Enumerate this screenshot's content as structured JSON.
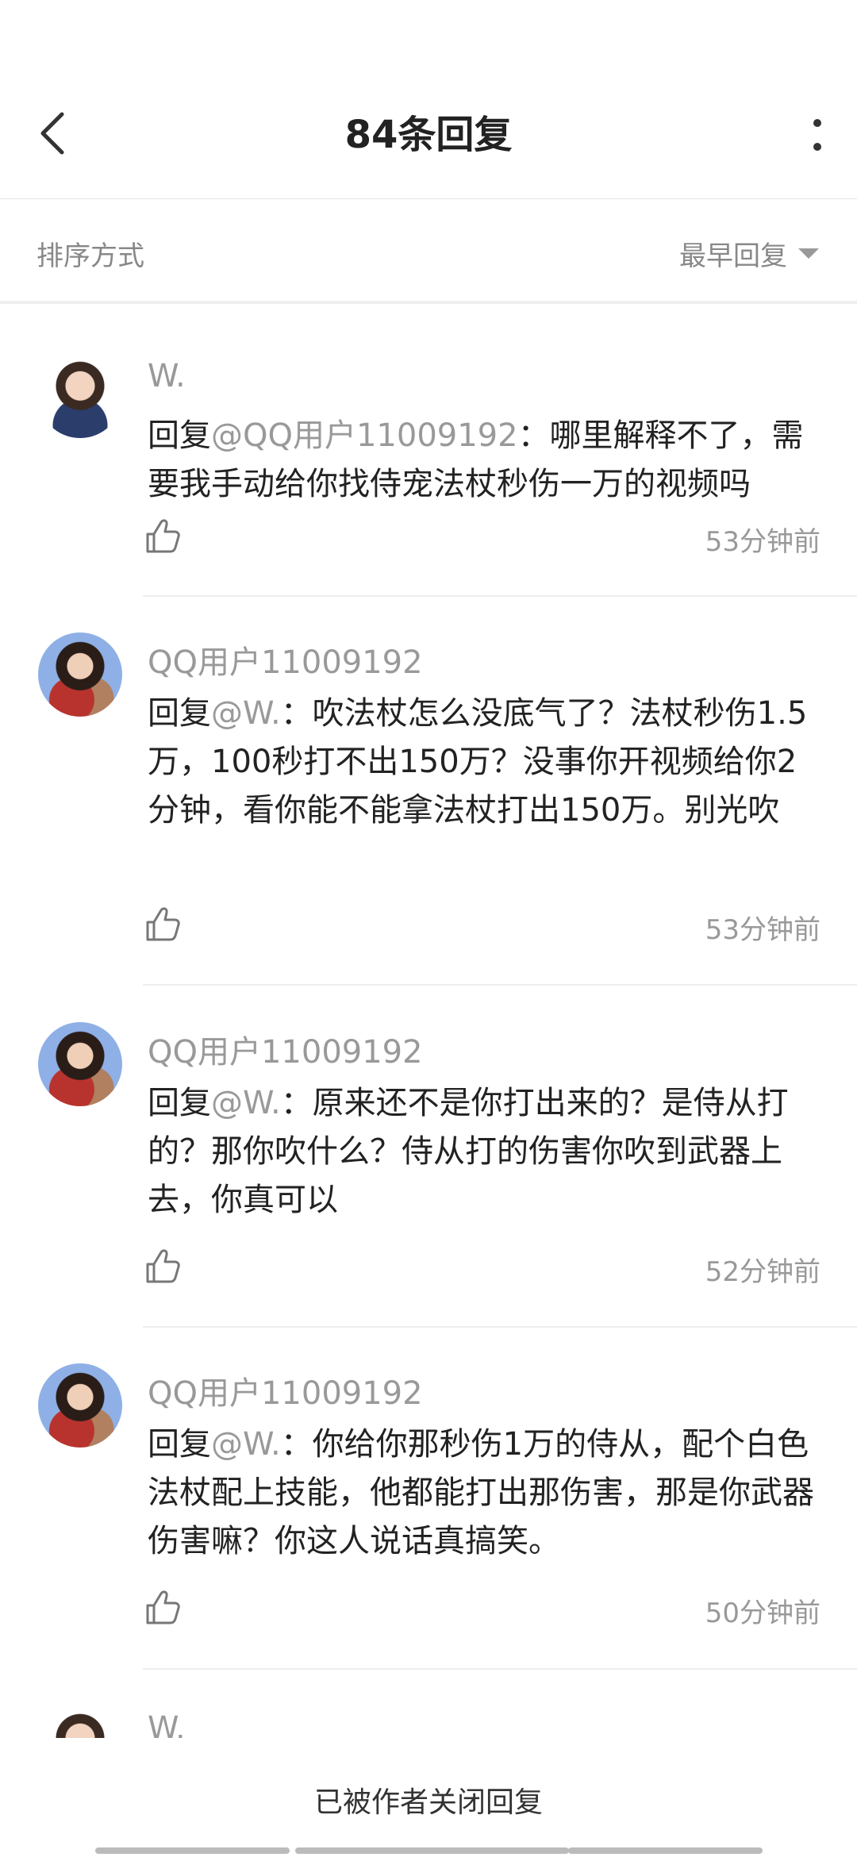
{
  "header": {
    "title": "84条回复",
    "back_icon": "chevron-left-icon",
    "more_icon": "vertical-dots-icon"
  },
  "sort": {
    "label": "排序方式",
    "value": "最早回复"
  },
  "comments": [
    {
      "author": "W.",
      "reply_prefix": "回复",
      "mention": "@QQ用户11009192",
      "text": "：哪里解释不了，需要我手动给你找侍宠法杖秒伤一万的视频吗",
      "time": "53分钟前"
    },
    {
      "author": "QQ用户11009192",
      "reply_prefix": "回复",
      "mention": "@W.",
      "text": "：吹法杖怎么没底气了？法杖秒伤1.5万，100秒打不出150万？没事你开视频给你2分钟，看你能不能拿法杖打出150万。别光吹",
      "time": "53分钟前"
    },
    {
      "author": "QQ用户11009192",
      "reply_prefix": "回复",
      "mention": "@W.",
      "text": "：原来还不是你打出来的？是侍从打的？那你吹什么？侍从打的伤害你吹到武器上去，你真可以",
      "time": "52分钟前"
    },
    {
      "author": "QQ用户11009192",
      "reply_prefix": "回复",
      "mention": "@W.",
      "text": "：你给你那秒伤1万的侍从，配个白色法杖配上技能，他都能打出那伤害，那是你武器伤害嘛？你这人说话真搞笑。",
      "time": "50分钟前"
    },
    {
      "author": "W.",
      "reply_prefix": "",
      "mention": "",
      "text": "",
      "time": ""
    }
  ],
  "footer": {
    "closed_note": "已被作者关闭回复"
  },
  "colors": {
    "text_primary": "#222222",
    "text_secondary": "#999999",
    "divider": "#eeeeee"
  }
}
